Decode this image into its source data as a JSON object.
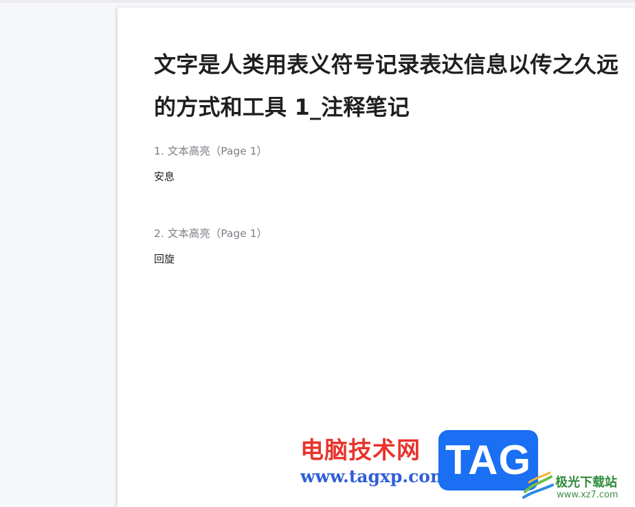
{
  "document": {
    "title": "文字是人类用表义符号记录表达信息以传之久远的方式和工具 1_注释笔记"
  },
  "notes": [
    {
      "header": "1. 文本高亮（Page 1）",
      "content": "安息"
    },
    {
      "header": "2. 文本高亮（Page 1）",
      "content": "回旋"
    }
  ],
  "watermark": {
    "brand": "电脑技术网",
    "url": "www.tagxp.com",
    "tag": "TAG",
    "site_name": "极光下载站",
    "site_url": "www.xz7.com"
  },
  "colors": {
    "background": "#f6f7f9",
    "page": "#ffffff",
    "note_header": "#7b7f86",
    "watermark_red": "#e8332c",
    "watermark_blue": "#1a6ff2"
  }
}
